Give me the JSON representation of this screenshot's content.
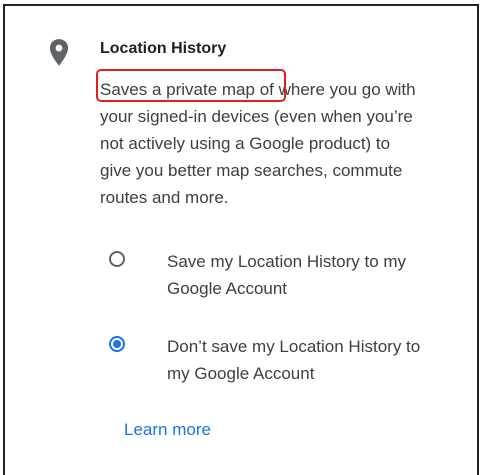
{
  "section": {
    "icon": "location-pin-icon",
    "title": "Location History",
    "description_lines": [
      "Saves a private map of where you go with",
      "your signed-in devices (even when you’re",
      "not actively using a Google product) to",
      "give you better map searches, commute",
      "routes and more."
    ]
  },
  "options": [
    {
      "label_lines": [
        "Save my Location History to my",
        "Google Account"
      ],
      "selected": false
    },
    {
      "label_lines": [
        "Don’t save my Location History to",
        "my Google Account"
      ],
      "selected": true
    }
  ],
  "learn_more_label": "Learn more",
  "colors": {
    "accent": "#1a73e8",
    "highlight": "#e02020",
    "text": "#3c4043"
  }
}
